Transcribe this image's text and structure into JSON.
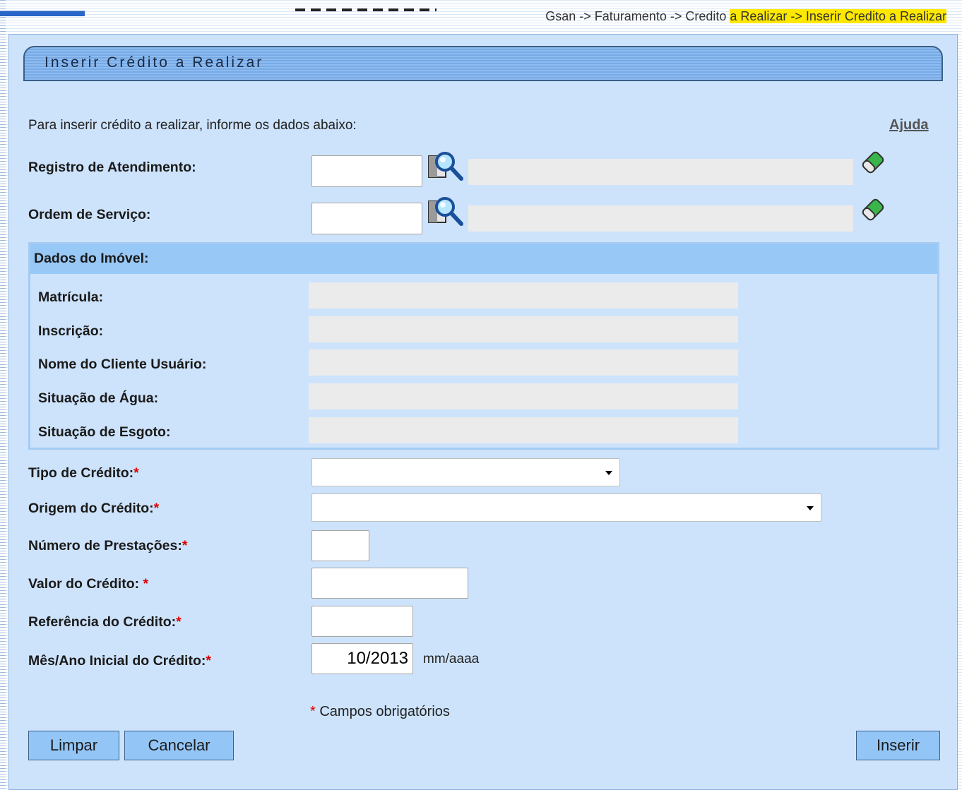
{
  "breadcrumb": {
    "prefix": "Gsan -> Faturamento -> Credito ",
    "highlight": "a Realizar -> Inserir Credito a Realizar"
  },
  "title": "Inserir Crédito a Realizar",
  "instruction": "Para inserir crédito a realizar, informe os dados abaixo:",
  "help_label": "Ajuda",
  "fields": {
    "registro_atendimento": {
      "label": "Registro de Atendimento:",
      "value": "",
      "description": ""
    },
    "ordem_servico": {
      "label": "Ordem de Serviço:",
      "value": "",
      "description": ""
    }
  },
  "imovel": {
    "title": "Dados do Imóvel:",
    "matricula_label": "Matrícula:",
    "matricula": "",
    "inscricao_label": "Inscrição:",
    "inscricao": "",
    "nome_cliente_label": "Nome do Cliente Usuário:",
    "nome_cliente": "",
    "situacao_agua_label": "Situação de Água:",
    "situacao_agua": "",
    "situacao_esgoto_label": "Situação de Esgoto:",
    "situacao_esgoto": ""
  },
  "credit": {
    "tipo_label": "Tipo de Crédito:",
    "tipo_selected": "",
    "origem_label": "Origem do Crédito:",
    "origem_selected": "",
    "prestacoes_label": "Número de Prestações:",
    "prestacoes": "",
    "valor_label": "Valor do Crédito: ",
    "valor": "",
    "referencia_label": "Referência do Crédito:",
    "referencia": "",
    "mes_ano_label": "Mês/Ano Inicial do Crédito:",
    "mes_ano": "10/2013",
    "mes_ano_hint": "mm/aaaa"
  },
  "required_marker": "*",
  "required_note": "Campos obrigatórios",
  "buttons": {
    "limpar": "Limpar",
    "cancelar": "Cancelar",
    "inserir": "Inserir"
  }
}
